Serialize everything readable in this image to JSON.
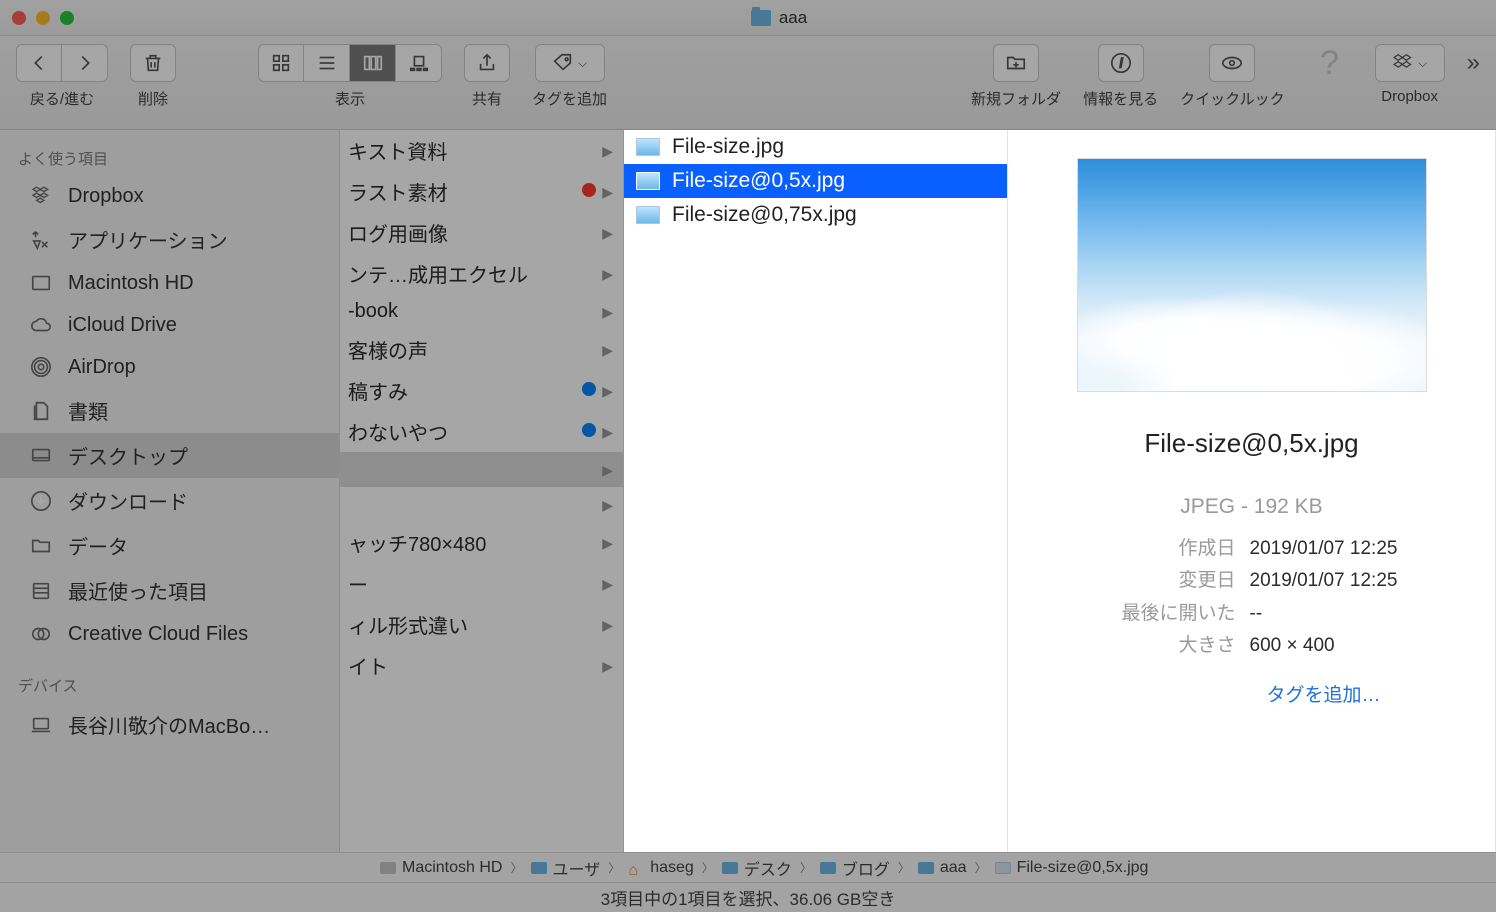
{
  "title": "aaa",
  "toolbar": {
    "back_forward_label": "戻る/進む",
    "delete_label": "削除",
    "view_label": "表示",
    "share_label": "共有",
    "tags_label": "タグを追加",
    "newfolder_label": "新規フォルダ",
    "getinfo_label": "情報を見る",
    "quicklook_label": "クイックルック",
    "dropbox_label": "Dropbox"
  },
  "sidebar": {
    "favorites_header": "よく使う項目",
    "items": [
      "Dropbox",
      "アプリケーション",
      "Macintosh HD",
      "iCloud Drive",
      "AirDrop",
      "書類",
      "デスクトップ",
      "ダウンロード",
      "データ",
      "最近使った項目",
      "Creative Cloud Files"
    ],
    "devices_header": "デバイス",
    "device0": "長谷川敬介のMacBo…"
  },
  "col1": [
    {
      "label": "キスト資料",
      "tag": null
    },
    {
      "label": "ラスト素材",
      "tag": "#ff3b30"
    },
    {
      "label": "ログ用画像",
      "tag": null
    },
    {
      "label": "ンテ…成用エクセル",
      "tag": null
    },
    {
      "label": "-book",
      "tag": null
    },
    {
      "label": "客様の声",
      "tag": null
    },
    {
      "label": "稿すみ",
      "tag": "#0a84ff"
    },
    {
      "label": "わないやつ",
      "tag": "#0a84ff"
    },
    {
      "label": "",
      "tag": null
    },
    {
      "label": "",
      "tag": null
    },
    {
      "label": "ャッチ780×480",
      "tag": null
    },
    {
      "label": "ー",
      "tag": null
    },
    {
      "label": "ィル形式違い",
      "tag": null
    },
    {
      "label": "イト",
      "tag": null
    }
  ],
  "col2": [
    {
      "label": "File-size.jpg",
      "sel": false
    },
    {
      "label": "File-size@0,5x.jpg",
      "sel": true
    },
    {
      "label": "File-size@0,75x.jpg",
      "sel": false
    }
  ],
  "preview": {
    "filename": "File-size@0,5x.jpg",
    "kind_size": "JPEG - 192 KB",
    "rows": [
      {
        "k": "作成日",
        "v": "2019/01/07 12:25"
      },
      {
        "k": "変更日",
        "v": "2019/01/07 12:25"
      },
      {
        "k": "最後に開いた",
        "v": "--"
      },
      {
        "k": "大きさ",
        "v": "600 × 400"
      }
    ],
    "add_tags": "タグを追加…"
  },
  "pathbar": [
    "Macintosh HD",
    "ユーザ",
    "haseg",
    "デスク",
    "ブログ",
    "aaa",
    "File-size@0,5x.jpg"
  ],
  "status": "3項目中の1項目を選択、36.06 GB空き"
}
